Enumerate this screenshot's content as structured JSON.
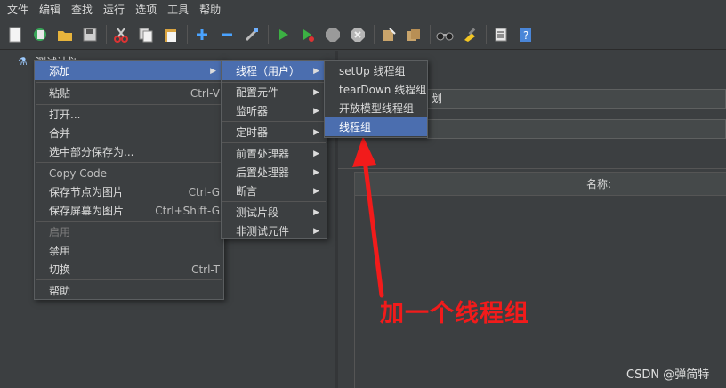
{
  "menubar": [
    "文件",
    "编辑",
    "查找",
    "运行",
    "选项",
    "工具",
    "帮助"
  ],
  "toolbar_icons": [
    "new-icon",
    "templates-icon",
    "open-icon",
    "save-icon",
    "cut-icon",
    "copy-icon",
    "paste-icon",
    "expand-icon",
    "collapse-icon",
    "toggle-icon",
    "start-icon",
    "start-no-pause-icon",
    "stop-icon",
    "shutdown-icon",
    "clear-icon",
    "clear-all-icon",
    "search-icon",
    "reset-search-icon",
    "function-helper-icon",
    "help-icon"
  ],
  "tree": {
    "root_label": "测试计划"
  },
  "right_panel": {
    "name_value": "划",
    "table_header": "名称:"
  },
  "context_menu": {
    "add": "添加",
    "paste": "粘贴",
    "paste_sc": "Ctrl-V",
    "open": "打开...",
    "merge": "合并",
    "save_selection": "选中部分保存为...",
    "copy_code": "Copy Code",
    "save_node_image": "保存节点为图片",
    "save_node_image_sc": "Ctrl-G",
    "save_screen_image": "保存屏幕为图片",
    "save_screen_image_sc": "Ctrl+Shift-G",
    "enable": "启用",
    "disable": "禁用",
    "toggle": "切换",
    "toggle_sc": "Ctrl-T",
    "help": "帮助"
  },
  "add_submenu": {
    "threads": "线程（用户）",
    "config": "配置元件",
    "listener": "监听器",
    "timer": "定时器",
    "pre_processor": "前置处理器",
    "post_processor": "后置处理器",
    "assertion": "断言",
    "test_fragment": "测试片段",
    "non_test": "非测试元件"
  },
  "threads_submenu": {
    "setup": "setUp 线程组",
    "teardown": "tearDown 线程组",
    "open_model": "开放模型线程组",
    "thread_group": "线程组"
  },
  "annotation": "加一个线程组",
  "watermark": "CSDN @弹简特",
  "colors": {
    "background": "#3c3f41",
    "selection": "#4b6eaf",
    "annotation_red": "#f21b1b"
  }
}
